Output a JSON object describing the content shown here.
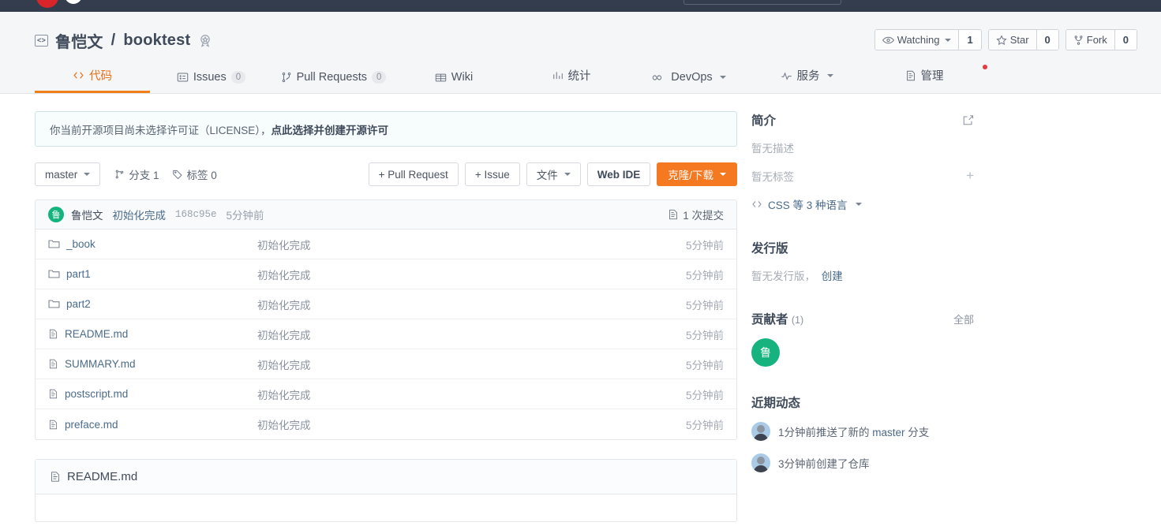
{
  "topnav": {
    "logo_icon": "gitee-logo-icon",
    "search_placeholder": "",
    "icons": [
      "bell-icon",
      "plus-icon",
      "avatar-icon"
    ]
  },
  "repo": {
    "code_icon": "code-brackets-icon",
    "owner": "鲁恺文",
    "separator": "/",
    "name": "booktest",
    "badge_icon": "award-badge-icon",
    "watching_label": "Watching",
    "watching_count": "1",
    "star_label": "Star",
    "star_count": "0",
    "fork_label": "Fork",
    "fork_count": "0"
  },
  "tabs": [
    {
      "label": "代码",
      "icon": "code-icon",
      "badge": "",
      "active": true,
      "caret": false,
      "dot": false
    },
    {
      "label": "Issues",
      "icon": "issue-icon",
      "badge": "0",
      "active": false,
      "caret": false,
      "dot": false
    },
    {
      "label": "Pull Requests",
      "icon": "pull-request-icon",
      "badge": "0",
      "active": false,
      "caret": false,
      "dot": false
    },
    {
      "label": "Wiki",
      "icon": "wiki-icon",
      "badge": "",
      "active": false,
      "caret": false,
      "dot": false
    },
    {
      "label": "统计",
      "icon": "chart-icon",
      "badge": "",
      "active": false,
      "caret": false,
      "dot": false
    },
    {
      "label": "DevOps",
      "icon": "infinity-icon",
      "badge": "",
      "active": false,
      "caret": true,
      "dot": false
    },
    {
      "label": "服务",
      "icon": "pulse-icon",
      "badge": "",
      "active": false,
      "caret": true,
      "dot": false
    },
    {
      "label": "管理",
      "icon": "settings-doc-icon",
      "badge": "",
      "active": false,
      "caret": false,
      "dot": true
    }
  ],
  "notice": {
    "text": "你当前开源项目尚未选择许可证（LICENSE），",
    "link": "点此选择并创建开源许可"
  },
  "toolbar": {
    "branch": "master",
    "branches_label": "分支 1",
    "tags_label": "标签 0",
    "branch_icon": "branch-icon",
    "tag_icon": "tag-icon",
    "pull_request_button": "+ Pull Request",
    "issue_button": "+ Issue",
    "files_button": "文件",
    "web_ide_button": "Web IDE",
    "clone_button": "克隆/下载"
  },
  "commit_bar": {
    "avatar_initial": "鲁",
    "author": "鲁恺文",
    "message": "初始化完成",
    "sha": "168c95e",
    "time": "5分钟前",
    "count_label": "1 次提交",
    "count_icon": "commit-list-icon"
  },
  "files": {
    "rows": [
      {
        "name": "_book",
        "type": "folder",
        "message": "初始化完成",
        "time": "5分钟前"
      },
      {
        "name": "part1",
        "type": "folder",
        "message": "初始化完成",
        "time": "5分钟前"
      },
      {
        "name": "part2",
        "type": "folder",
        "message": "初始化完成",
        "time": "5分钟前"
      },
      {
        "name": "README.md",
        "type": "file",
        "message": "初始化完成",
        "time": "5分钟前"
      },
      {
        "name": "SUMMARY.md",
        "type": "file",
        "message": "初始化完成",
        "time": "5分钟前"
      },
      {
        "name": "postscript.md",
        "type": "file",
        "message": "初始化完成",
        "time": "5分钟前"
      },
      {
        "name": "preface.md",
        "type": "file",
        "message": "初始化完成",
        "time": "5分钟前"
      }
    ]
  },
  "readme": {
    "title": "README.md",
    "icon": "file-doc-icon"
  },
  "sidebar": {
    "about_title": "简介",
    "edit_icon": "edit-square-icon",
    "no_description": "暂无描述",
    "no_tags": "暂无标签",
    "add_tag_icon": "plus-icon",
    "languages": "CSS 等 3 种语言",
    "languages_icon": "code-icon",
    "releases_title": "发行版",
    "no_release": "暂无发行版，",
    "create_release": "创建",
    "contributors_title": "贡献者",
    "contributors_count": "(1)",
    "contributors_all": "全部",
    "contributor_initial": "鲁",
    "activity_title": "近期动态",
    "activities": [
      {
        "prefix": "1分钟前推送了新的 ",
        "link": "master",
        "suffix": " 分支"
      },
      {
        "prefix": "3分钟前创建了仓库",
        "link": "",
        "suffix": ""
      }
    ]
  },
  "colors": {
    "accent_orange": "#f47920",
    "nav_dark": "#333d4d",
    "link_blue": "#4a6b8a",
    "avatar_green": "#16b37f"
  }
}
